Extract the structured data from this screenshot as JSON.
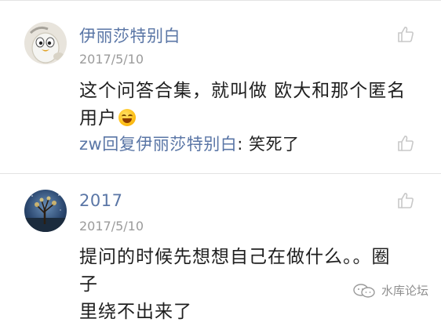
{
  "comments": [
    {
      "username": "伊丽莎特别白",
      "date": "2017/5/10",
      "text_line1": "这个问答合集，就叫做  欧大和那个匿名",
      "text_line2": "用户",
      "emoji": "smiling-face-emoji",
      "reply": {
        "who": "zw回复伊丽莎特别白",
        "separator": ": ",
        "text": "笑死了"
      }
    },
    {
      "username": "2017",
      "date": "2017/5/10",
      "text_line1": "提问的时候先想想自己在做什么。。圈子",
      "text_line2": "里绕不出来了"
    }
  ],
  "watermark": {
    "text": "水库论坛",
    "icon": "wechat-icon"
  },
  "colors": {
    "username": "#5a76a6",
    "date": "#9b9b9b",
    "text": "#1f1f1f",
    "like_icon": "#c8c8c8"
  }
}
